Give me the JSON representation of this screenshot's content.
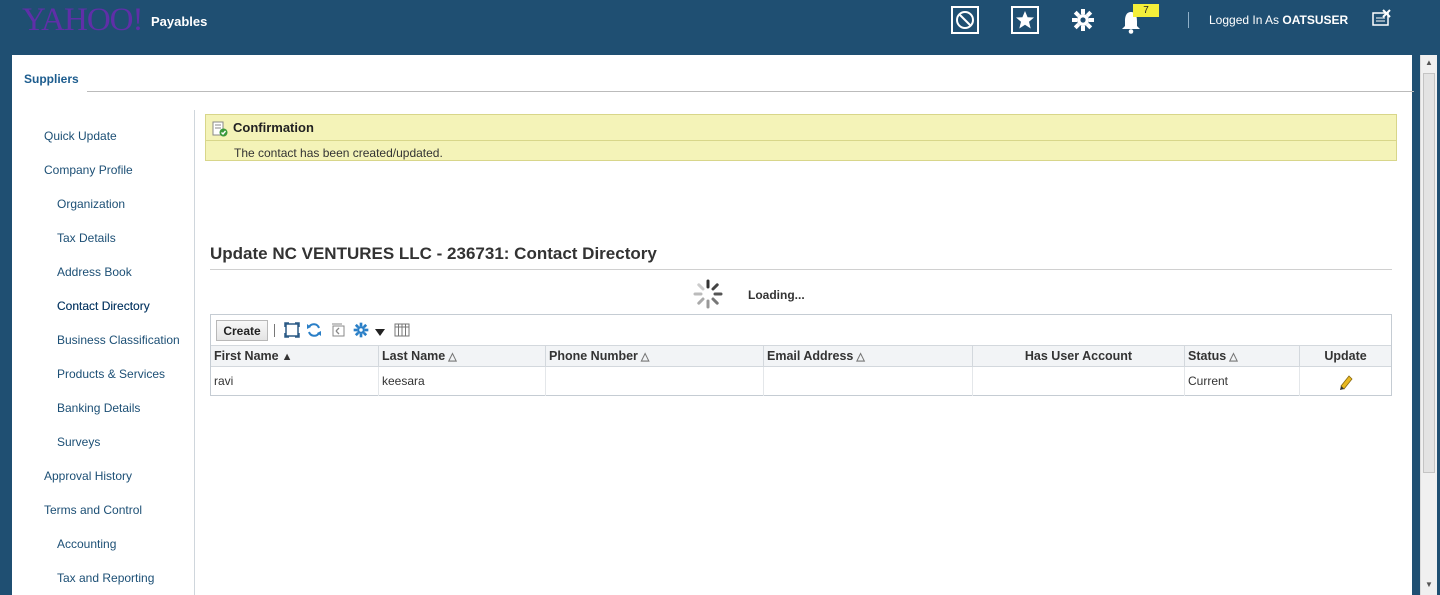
{
  "header": {
    "logo": "YAHOO!",
    "app_name": "Payables",
    "notification_count": "7",
    "logged_in_prefix": "Logged In As",
    "username": "OATSUSER",
    "icons": [
      "navigator-icon",
      "favorites-star-icon",
      "settings-gear-icon",
      "notifications-bell-icon",
      "close-window-icon"
    ]
  },
  "tabs": [
    {
      "label": "Suppliers"
    }
  ],
  "sidebar": {
    "items": [
      {
        "label": "Quick Update"
      },
      {
        "label": "Company Profile"
      },
      {
        "label": "Organization"
      },
      {
        "label": "Tax Details"
      },
      {
        "label": "Address Book"
      },
      {
        "label": "Contact Directory"
      },
      {
        "label": "Business Classification"
      },
      {
        "label": "Products & Services"
      },
      {
        "label": "Banking Details"
      },
      {
        "label": "Surveys"
      },
      {
        "label": "Approval History"
      },
      {
        "label": "Terms and Control"
      },
      {
        "label": "Accounting"
      },
      {
        "label": "Tax and Reporting"
      }
    ],
    "active": "Contact Directory"
  },
  "confirmation": {
    "title": "Confirmation",
    "message": "The contact has been created/updated."
  },
  "page_title": "Update NC VENTURES LLC - 236731: Contact Directory",
  "loading_text": "Loading...",
  "table": {
    "create_label": "Create",
    "toolbar_icons": [
      "detach-icon",
      "refresh-icon",
      "undo-icon",
      "settings-gear-icon",
      "freeze-columns-icon"
    ],
    "columns": [
      "First Name",
      "Last Name",
      "Phone Number",
      "Email Address",
      "Has User Account",
      "Status",
      "Update"
    ],
    "rows": [
      {
        "first_name": "ravi",
        "last_name": "keesara",
        "phone": "",
        "email": "",
        "has_user_account": "",
        "status": "Current"
      }
    ]
  },
  "colors": {
    "header_bg": "#1f4f72",
    "confirm_bg": "#f4f3b8",
    "link": "#1c4f75"
  }
}
